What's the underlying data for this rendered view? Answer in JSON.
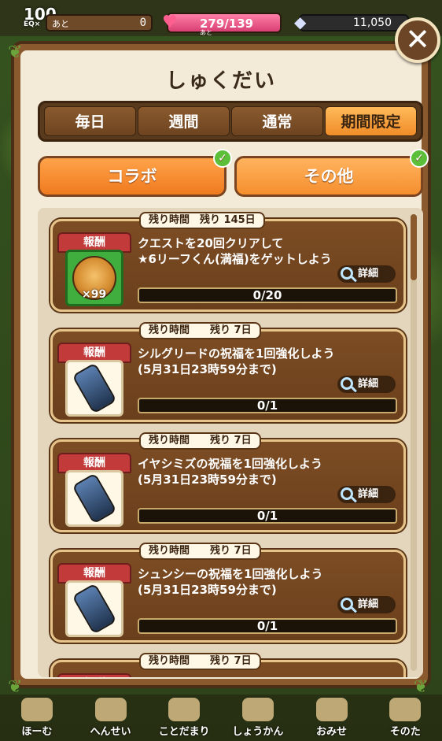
{
  "status": {
    "level": "100",
    "level_sub": "EQ×",
    "exp_label": "あと",
    "exp_value": "0",
    "stamina_value": "279/139",
    "stamina_sub": "あと",
    "coins_value": "11,050"
  },
  "panel": {
    "title": "しゅくだい"
  },
  "period_tabs": [
    {
      "label": "毎日"
    },
    {
      "label": "週間"
    },
    {
      "label": "通常"
    },
    {
      "label": "期間限定"
    }
  ],
  "category_buttons": [
    {
      "label": "コラボ"
    },
    {
      "label": "その他"
    }
  ],
  "missions": [
    {
      "time_label": "残り時間　残り 145日",
      "reward_label": "報酬",
      "line1": "クエストを20回クリアして",
      "line2": "★6リーフくん(満福)をゲットしよう",
      "detail_label": "詳細",
      "progress_text": "0/20",
      "progress_fraction": 0,
      "quantity": "×99"
    },
    {
      "time_label": "残り時間　　残り 7日",
      "reward_label": "報酬",
      "line1": "シルグリードの祝福を1回強化しよう",
      "line2": "(5月31日23時59分まで)",
      "detail_label": "詳細",
      "progress_text": "0/1",
      "progress_fraction": 0
    },
    {
      "time_label": "残り時間　　残り 7日",
      "reward_label": "報酬",
      "line1": "イヤシミズの祝福を1回強化しよう",
      "line2": "(5月31日23時59分まで)",
      "detail_label": "詳細",
      "progress_text": "0/1",
      "progress_fraction": 0
    },
    {
      "time_label": "残り時間　　残り 7日",
      "reward_label": "報酬",
      "line1": "シュンシーの祝福を1回強化しよう",
      "line2": "(5月31日23時59分まで)",
      "detail_label": "詳細",
      "progress_text": "0/1",
      "progress_fraction": 0
    },
    {
      "time_label": "残り時間　　残り 7日",
      "reward_label": "報酬"
    }
  ],
  "bottom_nav": [
    {
      "label": "ほーむ"
    },
    {
      "label": "へんせい"
    },
    {
      "label": "ことだまり"
    },
    {
      "label": "しょうかん"
    },
    {
      "label": "おみせ"
    },
    {
      "label": "そのた"
    }
  ],
  "icons": {
    "close": "close-icon",
    "check": "check-icon",
    "detail": "magnifier-icon",
    "reward_bottle": "bottle-icon",
    "reward_character": "tanuki-icon"
  }
}
